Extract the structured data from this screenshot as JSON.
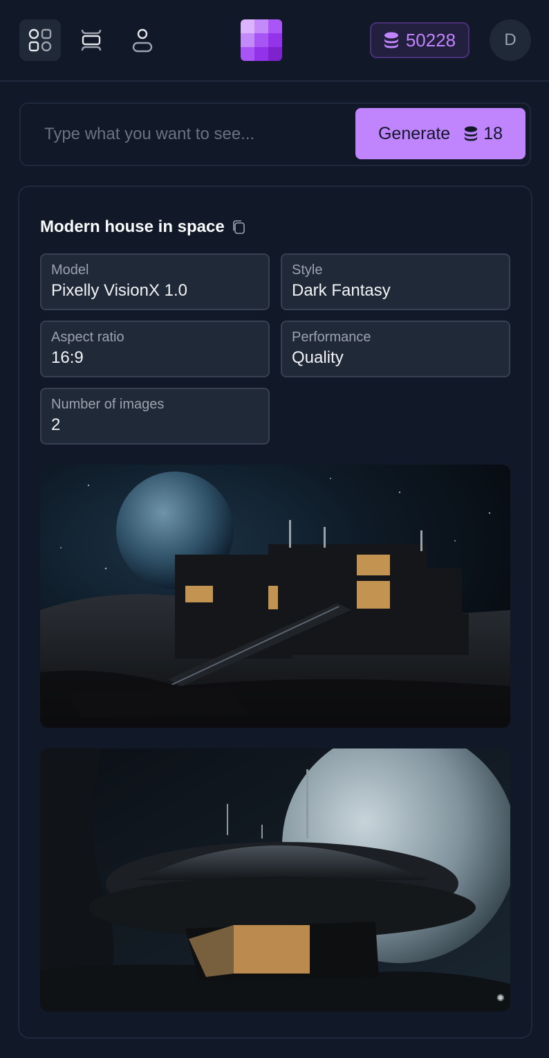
{
  "header": {
    "nav": [
      {
        "name": "gallery",
        "icon": "grid-apps-icon",
        "active": true
      },
      {
        "name": "generate",
        "icon": "image-frame-icon",
        "active": false
      },
      {
        "name": "profile",
        "icon": "user-icon",
        "active": false
      }
    ],
    "logo_colors": [
      "#dcb4fe",
      "#c58af9",
      "#aa55f5",
      "#c38af9",
      "#a855f6",
      "#9333ea",
      "#a955f6",
      "#9333e9",
      "#7e22ce"
    ],
    "credits": {
      "icon": "coins-stack-icon",
      "value": "50228"
    },
    "avatar_initial": "D"
  },
  "prompt": {
    "placeholder": "Type what you want to see...",
    "value": "",
    "generate_label": "Generate",
    "generate_cost": "18",
    "cost_icon": "coins-stack-icon"
  },
  "result": {
    "title": "Modern house in space",
    "copy_icon": "copy-icon",
    "fields": [
      {
        "label": "Model",
        "value": "Pixelly VisionX 1.0"
      },
      {
        "label": "Style",
        "value": "Dark Fantasy"
      },
      {
        "label": "Aspect ratio",
        "value": "16:9"
      },
      {
        "label": "Performance",
        "value": "Quality"
      },
      {
        "label": "Number of images",
        "value": "2"
      }
    ],
    "images": [
      {
        "alt": "Dark modern cantilevered house with staircase on rocky lunar terrain, large planet in starry sky"
      },
      {
        "alt": "Saucer-shaped dark house with lit glass base on rocky terrain, large moon behind"
      }
    ]
  },
  "colors": {
    "background": "#111827",
    "accent": "#c084fc",
    "field_bg": "#1f2937",
    "border": "#1e293b"
  }
}
